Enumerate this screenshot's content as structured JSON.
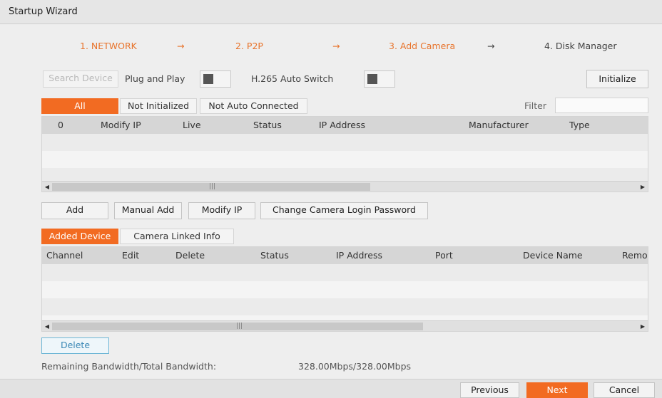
{
  "window": {
    "title": "Startup Wizard"
  },
  "steps": [
    {
      "label": "1. NETWORK"
    },
    {
      "label": "2. P2P"
    },
    {
      "label": "3. Add Camera"
    },
    {
      "label": "4. Disk Manager"
    }
  ],
  "step_arrow": "→",
  "toolbar": {
    "search_device": "Search Device",
    "plug_and_play": "Plug and Play",
    "h265_auto_switch": "H.265 Auto Switch",
    "initialize": "Initialize"
  },
  "search_tabs": [
    {
      "label": "All",
      "active": true
    },
    {
      "label": "Not Initialized",
      "active": false
    },
    {
      "label": "Not Auto Connected",
      "active": false
    }
  ],
  "filter": {
    "label": "Filter",
    "value": ""
  },
  "search_table": {
    "columns": [
      "0",
      "Modify IP",
      "Live",
      "Status",
      "IP Address",
      "Manufacturer",
      "Type"
    ]
  },
  "actions": {
    "add": "Add",
    "manual_add": "Manual Add",
    "modify_ip": "Modify IP",
    "change_password": "Change Camera Login Password"
  },
  "added_tabs": [
    {
      "label": "Added Device",
      "active": true
    },
    {
      "label": "Camera Linked Info",
      "active": false
    }
  ],
  "added_table": {
    "columns": [
      "Channel",
      "Edit",
      "Delete",
      "Status",
      "IP Address",
      "Port",
      "Device Name",
      "Remo"
    ]
  },
  "delete_button": "Delete",
  "bandwidth": {
    "label": "Remaining Bandwidth/Total Bandwidth:",
    "value": "328.00Mbps/328.00Mbps"
  },
  "footer": {
    "previous": "Previous",
    "next": "Next",
    "cancel": "Cancel"
  },
  "colors": {
    "accent": "#f26b22",
    "step_active": "#e8742c",
    "delete_border": "#6fb7d6"
  }
}
